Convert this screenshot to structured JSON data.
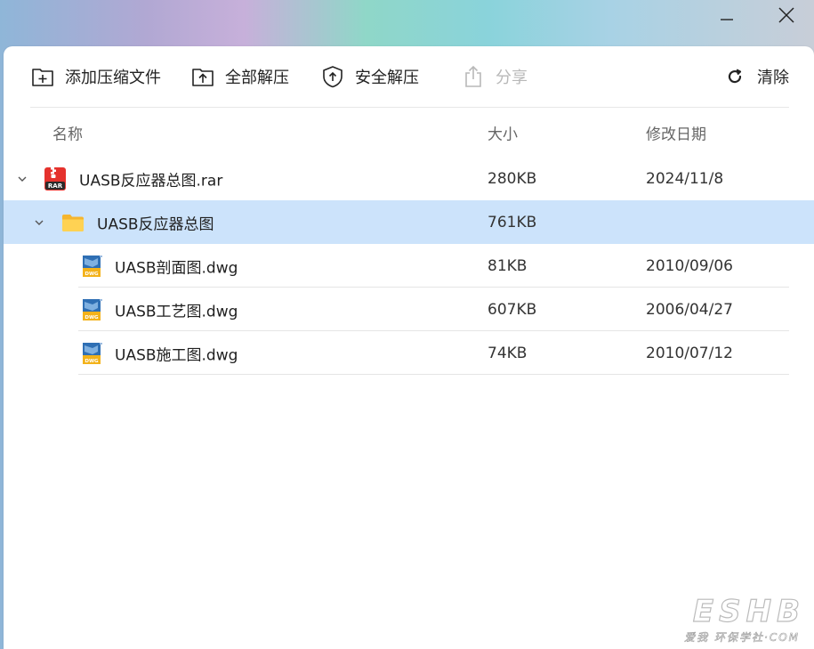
{
  "toolbar": {
    "add": {
      "label": "添加压缩文件",
      "icon": "add-archive-icon"
    },
    "extract_all": {
      "label": "全部解压",
      "icon": "extract-all-icon"
    },
    "safe_extract": {
      "label": "安全解压",
      "icon": "shield-icon"
    },
    "share": {
      "label": "分享",
      "icon": "share-icon",
      "enabled": false
    },
    "clear": {
      "label": "清除",
      "icon": "refresh-icon"
    }
  },
  "columns": {
    "name": "名称",
    "size": "大小",
    "date": "修改日期"
  },
  "files": [
    {
      "name": "UASB反应器总图.rar",
      "size": "280KB",
      "date": "2024/11/8",
      "type": "rar",
      "expanded": true,
      "level": 0
    },
    {
      "name": "UASB反应器总图",
      "size": "761KB",
      "date": "",
      "type": "folder",
      "expanded": true,
      "level": 1,
      "selected": true
    },
    {
      "name": "UASB剖面图.dwg",
      "size": "81KB",
      "date": "2010/09/06",
      "type": "dwg",
      "level": 2
    },
    {
      "name": "UASB工艺图.dwg",
      "size": "607KB",
      "date": "2006/04/27",
      "type": "dwg",
      "level": 2
    },
    {
      "name": "UASB施工图.dwg",
      "size": "74KB",
      "date": "2010/07/12",
      "type": "dwg",
      "level": 2
    }
  ],
  "icon_text": {
    "rar": "RAR",
    "dwg": "DWG"
  },
  "watermark": {
    "logo": "ESHB",
    "sub": "环保学社·COM",
    "badge": "爱我"
  },
  "colors": {
    "selected_row": "#cce3fb",
    "rar_red": "#e5322d",
    "folder_yellow": "#ffc83d",
    "dwg_blue": "#2f6fb4",
    "dwg_yellow": "#f3b21a"
  }
}
